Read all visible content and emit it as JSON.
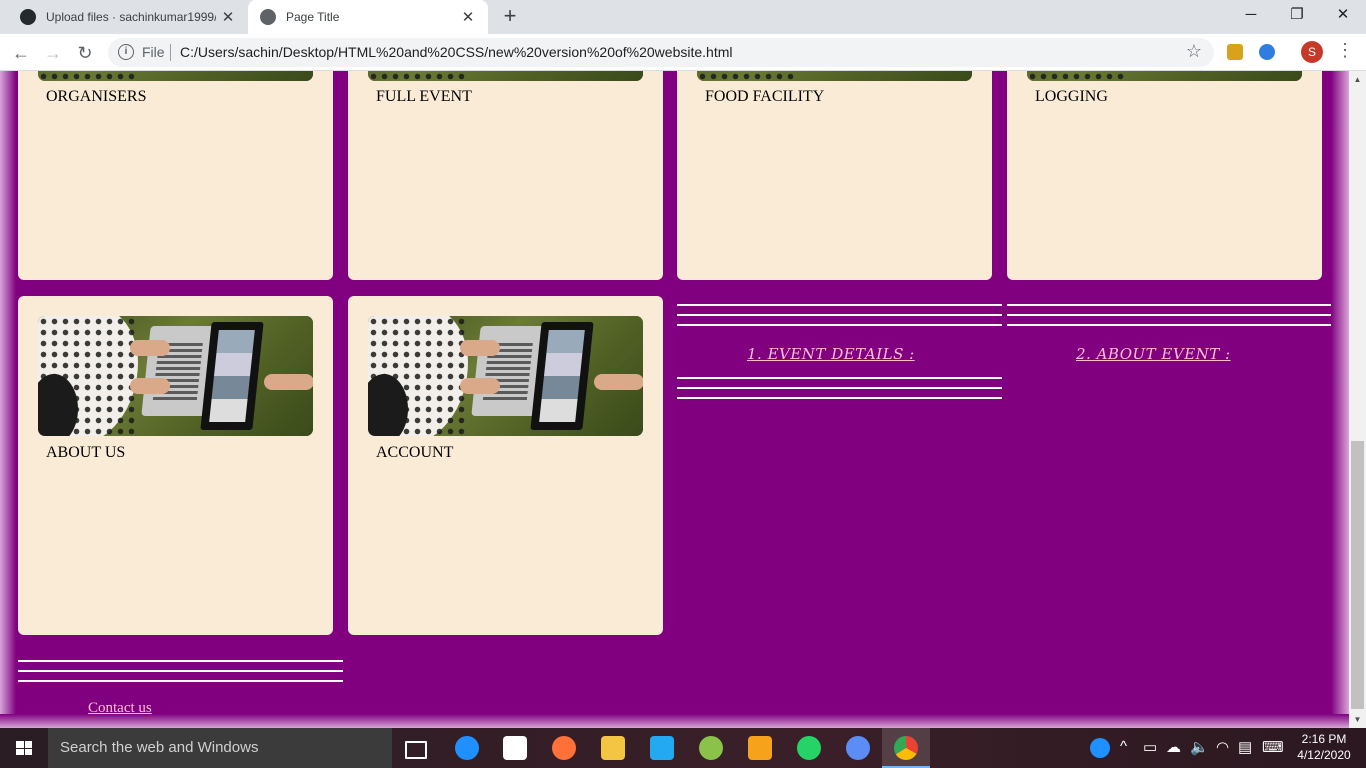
{
  "browser": {
    "tabs": [
      {
        "title": "Upload files · sachinkumar1999/I"
      },
      {
        "title": "Page Title"
      }
    ],
    "address": {
      "scheme_label": "File",
      "url": "C:/Users/sachin/Desktop/HTML%20and%20CSS/new%20version%20of%20website.html"
    },
    "profile_initial": "S"
  },
  "page": {
    "cards_top": [
      {
        "label": "ORGANISERS"
      },
      {
        "label": "FULL EVENT"
      },
      {
        "label": "FOOD FACILITY"
      },
      {
        "label": "LOGGING"
      }
    ],
    "cards_bottom": [
      {
        "label": "ABOUT US"
      },
      {
        "label": "ACCOUNT"
      }
    ],
    "section_links": [
      {
        "label": "1. EVENT DETAILS :"
      },
      {
        "label": "2. ABOUT EVENT :"
      }
    ],
    "footer": {
      "contact_label": "Contact us"
    },
    "colors": {
      "background": "#800080",
      "card": "#faebd7",
      "link": "#ffc0cb"
    }
  },
  "taskbar": {
    "search_placeholder": "Search the web and Windows",
    "time": "2:16 PM",
    "date": "4/12/2020"
  }
}
